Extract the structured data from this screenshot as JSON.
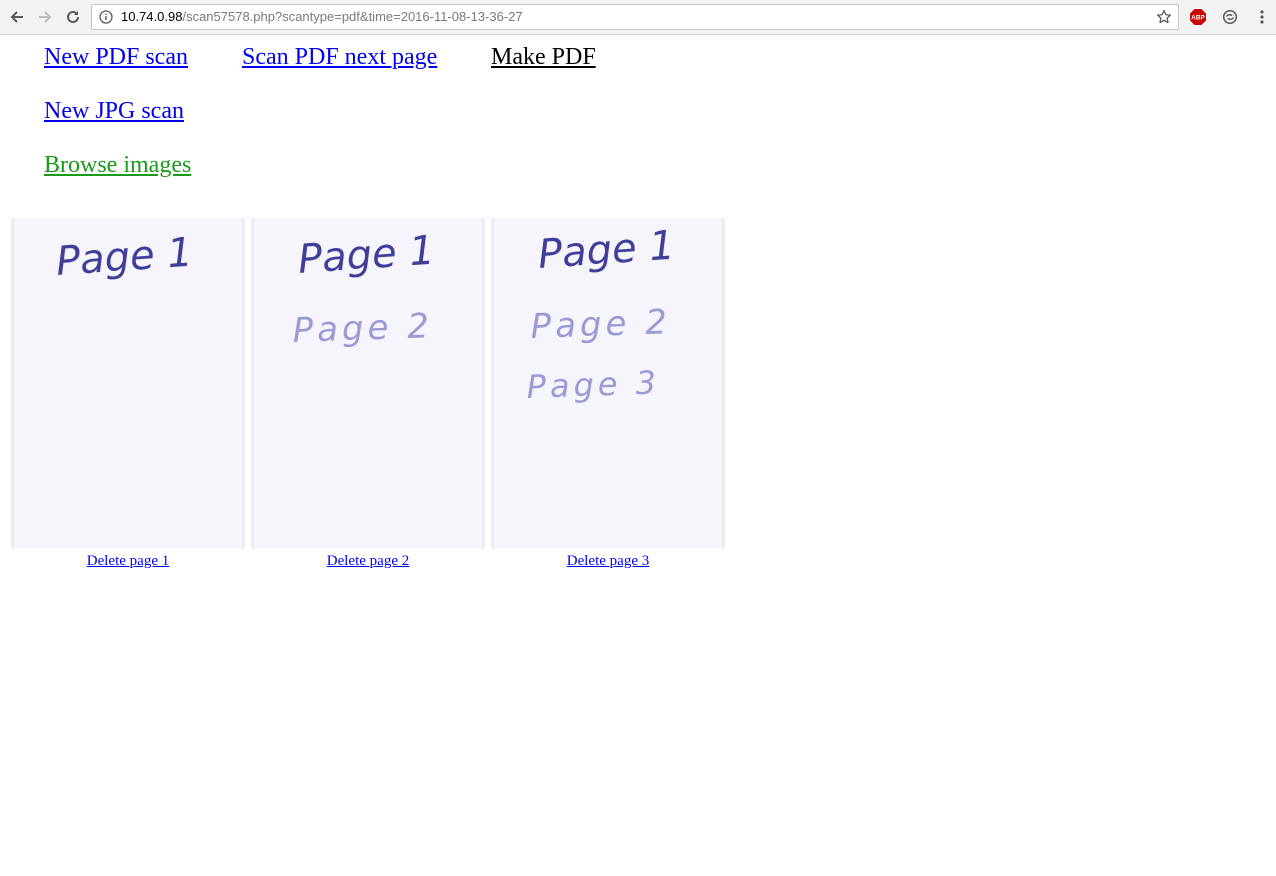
{
  "browser": {
    "url_host": "10.74.0.98",
    "url_path": "/scan57578.php?scantype=pdf&time=2016-11-08-13-36-27",
    "extension_label": "ABP",
    "icons": {
      "back": "back-arrow-icon",
      "forward": "forward-arrow-icon",
      "reload": "reload-icon",
      "info": "info-icon",
      "bookmark": "star-icon",
      "adblock": "adblock-icon",
      "sync": "sync-icon",
      "menu": "kebab-menu-icon"
    }
  },
  "nav": {
    "new_pdf_scan": "New PDF scan",
    "scan_pdf_next_page": "Scan PDF next page",
    "make_pdf": "Make PDF",
    "new_jpg_scan": "New JPG scan",
    "browse_images": "Browse images"
  },
  "pages": [
    {
      "handwriting": [
        "Page 1"
      ],
      "delete_label": "Delete page 1"
    },
    {
      "handwriting": [
        "Page 1",
        "Page 2"
      ],
      "delete_label": "Delete page 2"
    },
    {
      "handwriting": [
        "Page 1",
        "Page 2",
        "Page 3"
      ],
      "delete_label": "Delete page 3"
    }
  ],
  "colors": {
    "link": "#0000ee",
    "visited_green": "#1a9a1a",
    "ink_dark": "#3f3f9a",
    "ink_light": "#9a9ad6"
  }
}
